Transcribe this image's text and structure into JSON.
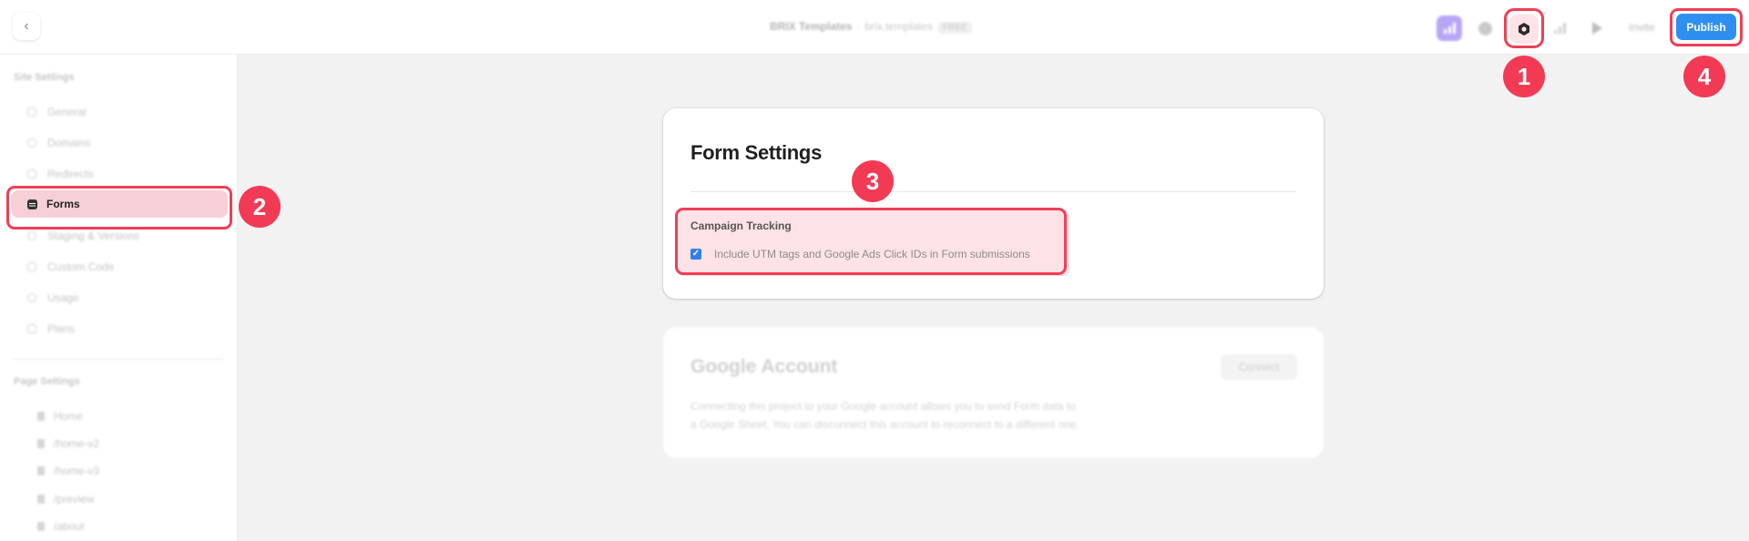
{
  "topbar": {
    "project_name": "BRIX Templates",
    "separator": "·",
    "domain": "brix.templates",
    "plan_badge": "FREE",
    "invite_label": "Invite",
    "publish_label": "Publish",
    "icons": [
      "chevron-left-icon",
      "analytics-icon",
      "globe-icon",
      "settings-icon",
      "signal-icon",
      "play-icon"
    ]
  },
  "sidebar": {
    "site_heading": "Site Settings",
    "site_items": [
      {
        "label": "General",
        "icon": "page-icon"
      },
      {
        "label": "Domains",
        "icon": "globe-icon"
      },
      {
        "label": "Redirects",
        "icon": "redirect-icon"
      },
      {
        "label": "Forms",
        "icon": "forms-icon",
        "active": true
      },
      {
        "label": "Staging & Versions",
        "icon": "staging-icon"
      },
      {
        "label": "Custom Code",
        "icon": "code-icon"
      },
      {
        "label": "Usage",
        "icon": "usage-icon"
      },
      {
        "label": "Plans",
        "icon": "plans-icon"
      }
    ],
    "page_heading": "Page Settings",
    "page_items": [
      {
        "label": "Home",
        "icon": "home-icon"
      },
      {
        "label": "/home-v2",
        "icon": "file-icon"
      },
      {
        "label": "/home-v3",
        "icon": "file-icon"
      },
      {
        "label": "/preview",
        "icon": "file-icon"
      },
      {
        "label": "/about",
        "icon": "file-icon"
      }
    ]
  },
  "form_settings": {
    "title": "Form Settings",
    "campaign_tracking": {
      "title": "Campaign Tracking",
      "checkbox_label": "Include UTM tags and Google Ads Click IDs in Form submissions",
      "checked": true
    }
  },
  "google_account": {
    "title": "Google Account",
    "connect_label": "Connect",
    "description_line1": "Connecting this project to your Google account allows you to send Form data to",
    "description_line2": "a Google Sheet. You can disconnect this account to reconnect to a different one."
  },
  "annotations": [
    {
      "number": "1",
      "target": "settings-button"
    },
    {
      "number": "2",
      "target": "sidebar-item-forms"
    },
    {
      "number": "3",
      "target": "campaign-tracking-section"
    },
    {
      "number": "4",
      "target": "publish-button"
    }
  ],
  "colors": {
    "highlight": "#f03e55",
    "badge": "#f33a55",
    "publish": "#2f8ff1",
    "analytics": "#b7a6f5",
    "checkbox": "#2f7fe8"
  }
}
